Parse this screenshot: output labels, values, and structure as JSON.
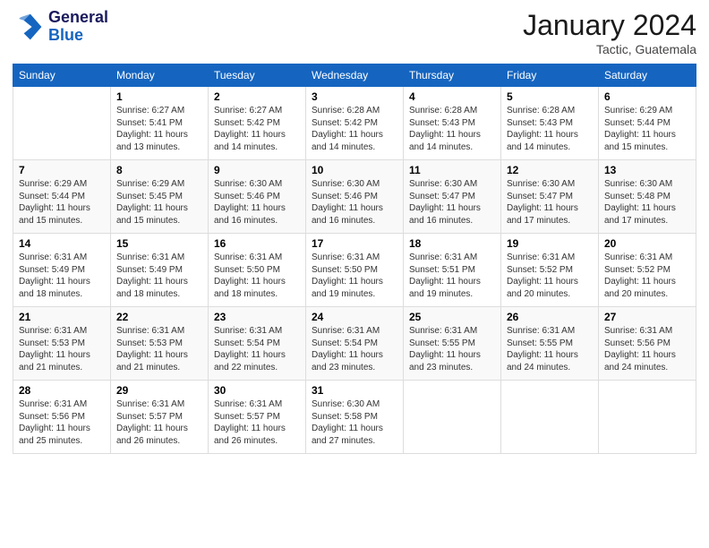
{
  "header": {
    "logo_line1": "General",
    "logo_line2": "Blue",
    "month_title": "January 2024",
    "location": "Tactic, Guatemala"
  },
  "days_header": [
    "Sunday",
    "Monday",
    "Tuesday",
    "Wednesday",
    "Thursday",
    "Friday",
    "Saturday"
  ],
  "rows": [
    [
      {
        "num": "",
        "lines": []
      },
      {
        "num": "1",
        "lines": [
          "Sunrise: 6:27 AM",
          "Sunset: 5:41 PM",
          "Daylight: 11 hours",
          "and 13 minutes."
        ]
      },
      {
        "num": "2",
        "lines": [
          "Sunrise: 6:27 AM",
          "Sunset: 5:42 PM",
          "Daylight: 11 hours",
          "and 14 minutes."
        ]
      },
      {
        "num": "3",
        "lines": [
          "Sunrise: 6:28 AM",
          "Sunset: 5:42 PM",
          "Daylight: 11 hours",
          "and 14 minutes."
        ]
      },
      {
        "num": "4",
        "lines": [
          "Sunrise: 6:28 AM",
          "Sunset: 5:43 PM",
          "Daylight: 11 hours",
          "and 14 minutes."
        ]
      },
      {
        "num": "5",
        "lines": [
          "Sunrise: 6:28 AM",
          "Sunset: 5:43 PM",
          "Daylight: 11 hours",
          "and 14 minutes."
        ]
      },
      {
        "num": "6",
        "lines": [
          "Sunrise: 6:29 AM",
          "Sunset: 5:44 PM",
          "Daylight: 11 hours",
          "and 15 minutes."
        ]
      }
    ],
    [
      {
        "num": "7",
        "lines": [
          "Sunrise: 6:29 AM",
          "Sunset: 5:44 PM",
          "Daylight: 11 hours",
          "and 15 minutes."
        ]
      },
      {
        "num": "8",
        "lines": [
          "Sunrise: 6:29 AM",
          "Sunset: 5:45 PM",
          "Daylight: 11 hours",
          "and 15 minutes."
        ]
      },
      {
        "num": "9",
        "lines": [
          "Sunrise: 6:30 AM",
          "Sunset: 5:46 PM",
          "Daylight: 11 hours",
          "and 16 minutes."
        ]
      },
      {
        "num": "10",
        "lines": [
          "Sunrise: 6:30 AM",
          "Sunset: 5:46 PM",
          "Daylight: 11 hours",
          "and 16 minutes."
        ]
      },
      {
        "num": "11",
        "lines": [
          "Sunrise: 6:30 AM",
          "Sunset: 5:47 PM",
          "Daylight: 11 hours",
          "and 16 minutes."
        ]
      },
      {
        "num": "12",
        "lines": [
          "Sunrise: 6:30 AM",
          "Sunset: 5:47 PM",
          "Daylight: 11 hours",
          "and 17 minutes."
        ]
      },
      {
        "num": "13",
        "lines": [
          "Sunrise: 6:30 AM",
          "Sunset: 5:48 PM",
          "Daylight: 11 hours",
          "and 17 minutes."
        ]
      }
    ],
    [
      {
        "num": "14",
        "lines": [
          "Sunrise: 6:31 AM",
          "Sunset: 5:49 PM",
          "Daylight: 11 hours",
          "and 18 minutes."
        ]
      },
      {
        "num": "15",
        "lines": [
          "Sunrise: 6:31 AM",
          "Sunset: 5:49 PM",
          "Daylight: 11 hours",
          "and 18 minutes."
        ]
      },
      {
        "num": "16",
        "lines": [
          "Sunrise: 6:31 AM",
          "Sunset: 5:50 PM",
          "Daylight: 11 hours",
          "and 18 minutes."
        ]
      },
      {
        "num": "17",
        "lines": [
          "Sunrise: 6:31 AM",
          "Sunset: 5:50 PM",
          "Daylight: 11 hours",
          "and 19 minutes."
        ]
      },
      {
        "num": "18",
        "lines": [
          "Sunrise: 6:31 AM",
          "Sunset: 5:51 PM",
          "Daylight: 11 hours",
          "and 19 minutes."
        ]
      },
      {
        "num": "19",
        "lines": [
          "Sunrise: 6:31 AM",
          "Sunset: 5:52 PM",
          "Daylight: 11 hours",
          "and 20 minutes."
        ]
      },
      {
        "num": "20",
        "lines": [
          "Sunrise: 6:31 AM",
          "Sunset: 5:52 PM",
          "Daylight: 11 hours",
          "and 20 minutes."
        ]
      }
    ],
    [
      {
        "num": "21",
        "lines": [
          "Sunrise: 6:31 AM",
          "Sunset: 5:53 PM",
          "Daylight: 11 hours",
          "and 21 minutes."
        ]
      },
      {
        "num": "22",
        "lines": [
          "Sunrise: 6:31 AM",
          "Sunset: 5:53 PM",
          "Daylight: 11 hours",
          "and 21 minutes."
        ]
      },
      {
        "num": "23",
        "lines": [
          "Sunrise: 6:31 AM",
          "Sunset: 5:54 PM",
          "Daylight: 11 hours",
          "and 22 minutes."
        ]
      },
      {
        "num": "24",
        "lines": [
          "Sunrise: 6:31 AM",
          "Sunset: 5:54 PM",
          "Daylight: 11 hours",
          "and 23 minutes."
        ]
      },
      {
        "num": "25",
        "lines": [
          "Sunrise: 6:31 AM",
          "Sunset: 5:55 PM",
          "Daylight: 11 hours",
          "and 23 minutes."
        ]
      },
      {
        "num": "26",
        "lines": [
          "Sunrise: 6:31 AM",
          "Sunset: 5:55 PM",
          "Daylight: 11 hours",
          "and 24 minutes."
        ]
      },
      {
        "num": "27",
        "lines": [
          "Sunrise: 6:31 AM",
          "Sunset: 5:56 PM",
          "Daylight: 11 hours",
          "and 24 minutes."
        ]
      }
    ],
    [
      {
        "num": "28",
        "lines": [
          "Sunrise: 6:31 AM",
          "Sunset: 5:56 PM",
          "Daylight: 11 hours",
          "and 25 minutes."
        ]
      },
      {
        "num": "29",
        "lines": [
          "Sunrise: 6:31 AM",
          "Sunset: 5:57 PM",
          "Daylight: 11 hours",
          "and 26 minutes."
        ]
      },
      {
        "num": "30",
        "lines": [
          "Sunrise: 6:31 AM",
          "Sunset: 5:57 PM",
          "Daylight: 11 hours",
          "and 26 minutes."
        ]
      },
      {
        "num": "31",
        "lines": [
          "Sunrise: 6:30 AM",
          "Sunset: 5:58 PM",
          "Daylight: 11 hours",
          "and 27 minutes."
        ]
      },
      {
        "num": "",
        "lines": []
      },
      {
        "num": "",
        "lines": []
      },
      {
        "num": "",
        "lines": []
      }
    ]
  ]
}
